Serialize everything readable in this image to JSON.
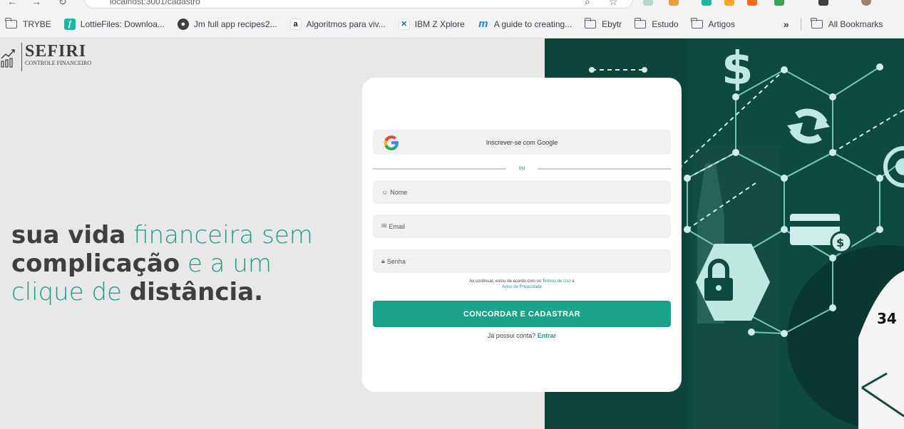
{
  "browser": {
    "url": "localhost:3001/cadastro",
    "bookmarks": [
      {
        "label": "TRYBE",
        "icon": "folder-icon"
      },
      {
        "label": "LottieFiles: Downloa...",
        "icon": "lottiefiles-icon",
        "color": "#1fb5a0"
      },
      {
        "label": "Jm full app recipes2...",
        "icon": "github-icon"
      },
      {
        "label": "Algoritmos para viv...",
        "icon": "amazon-icon"
      },
      {
        "label": "IBM Z Xplore",
        "icon": "ibm-icon"
      },
      {
        "label": "A guide to creating...",
        "icon": "m-icon",
        "color": "#1e88e5"
      },
      {
        "label": "Ebytr",
        "icon": "folder-icon"
      },
      {
        "label": "Estudo",
        "icon": "folder-icon"
      },
      {
        "label": "Artigos",
        "icon": "folder-icon"
      }
    ],
    "overflow_label": "»",
    "all_bookmarks": "All Bookmarks"
  },
  "logo": {
    "name": "SEFIRI",
    "tagline": "CONTROLE FINANCEIRO"
  },
  "hero": {
    "part1_bold": "sua vida",
    "part1_light": " financeira sem",
    "part2_bold": "complicação",
    "part2_light": " e a um",
    "part3_light": "clique de ",
    "part3_bold": "distância."
  },
  "form": {
    "google_label": "Inscrever-se com Google",
    "or_label": "ou",
    "name_placeholder": "Nome",
    "email_placeholder": "Email",
    "password_placeholder": "Senha",
    "terms_prefix": "Ao continuar, estou de acordo com os ",
    "terms_link": "Termos de Uso",
    "terms_and": " e",
    "privacy_link": "Aviso de Privacidade",
    "submit_label": "CONCORDAR E CADASTRAR",
    "login_prefix": "Já possui conta? ",
    "login_link": "Entrar"
  },
  "photo": {
    "number_label": "34"
  },
  "colors": {
    "accent": "#1a9e86",
    "button": "#1aa38a",
    "photo_overlay": "#0e4a42"
  }
}
